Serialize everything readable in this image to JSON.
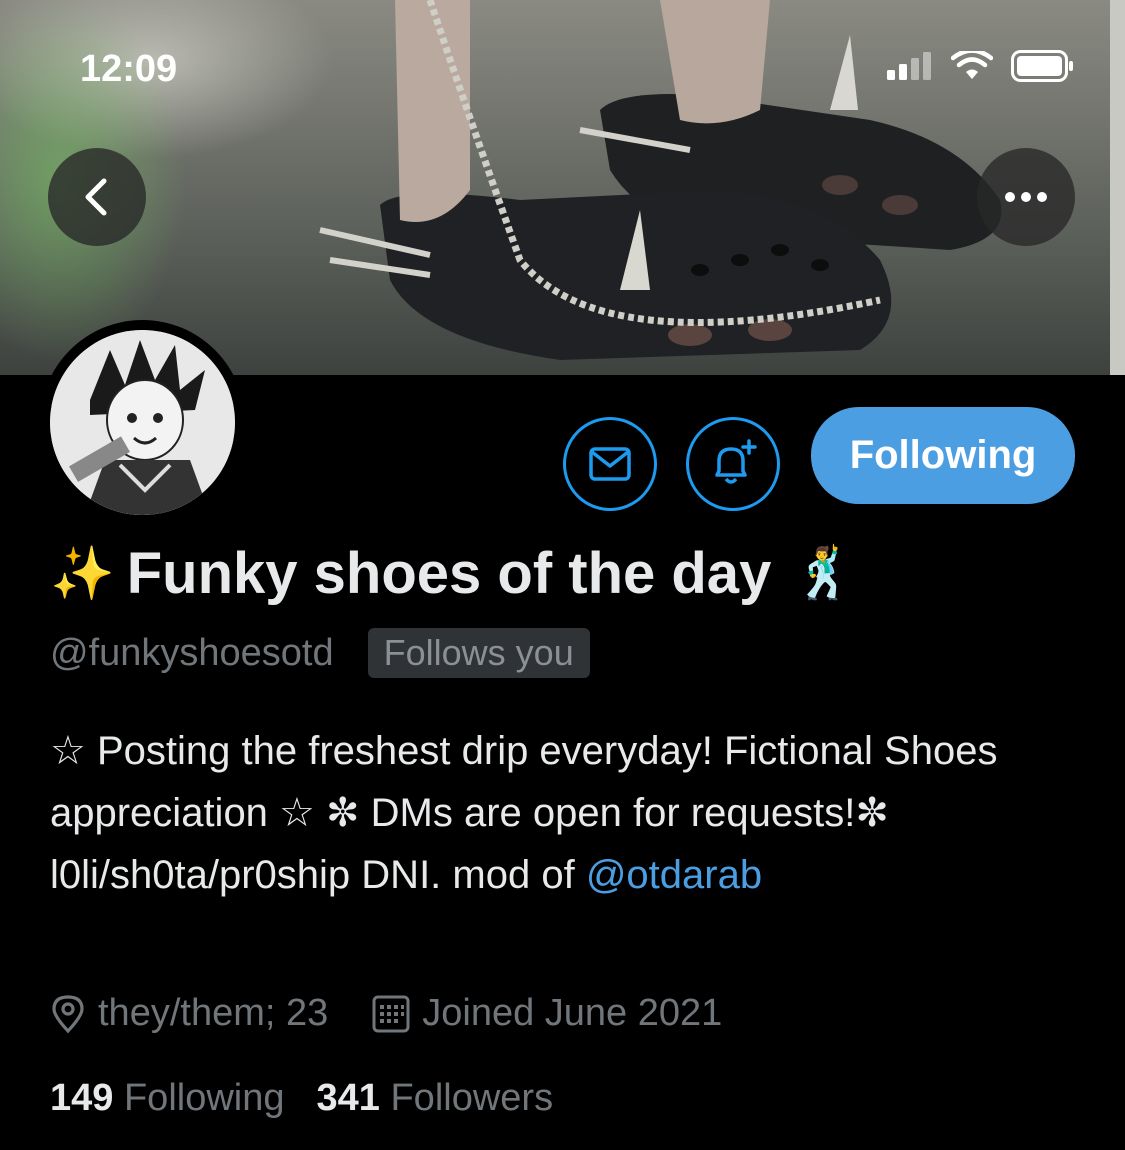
{
  "status_bar": {
    "time": "12:09"
  },
  "profile": {
    "display_name": "Funky shoes of the day",
    "name_prefix_emoji": "✨",
    "name_suffix_emoji": "🕺",
    "handle": "@funkyshoesotd",
    "follows_you": "Follows you",
    "follow_button": "Following",
    "bio_text": "☆ Posting the freshest drip everyday! Fictional Shoes appreciation ☆ ✼ DMs are open for requests!✼ l0li/sh0ta/pr0ship DNI. mod of ",
    "bio_mention": "@otdarab",
    "location": "they/them; 23",
    "joined": "Joined June 2021",
    "following_count": "149",
    "following_label": "Following",
    "followers_count": "341",
    "followers_label": "Followers"
  },
  "icons": {
    "back": "chevron-left-icon",
    "more": "more-horizontal-icon",
    "message": "envelope-icon",
    "notify": "bell-plus-icon",
    "location": "location-pin-icon",
    "calendar": "calendar-icon"
  },
  "colors": {
    "accent": "#4c9ee3",
    "background": "#000000",
    "muted_text": "#71767b"
  }
}
